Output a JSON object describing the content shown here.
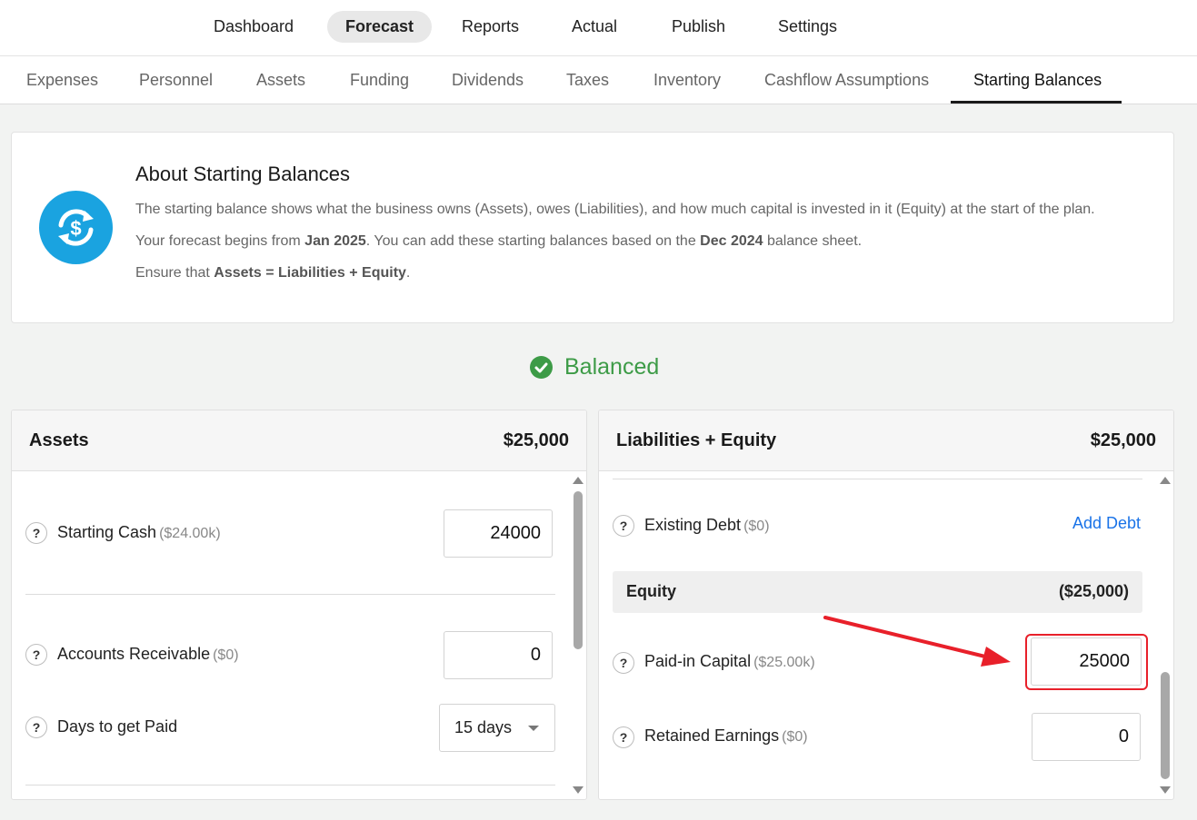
{
  "topnav": [
    "Dashboard",
    "Forecast",
    "Reports",
    "Actual",
    "Publish",
    "Settings"
  ],
  "subnav": [
    "Expenses",
    "Personnel",
    "Assets",
    "Funding",
    "Dividends",
    "Taxes",
    "Inventory",
    "Cashflow Assumptions",
    "Starting Balances"
  ],
  "about": {
    "title": "About Starting Balances",
    "line1": "The starting balance shows what the business owns (Assets), owes (Liabilities), and how much capital is invested in it (Equity) at the start of the plan.",
    "line2_a": "Your forecast begins from ",
    "line2_b": "Jan 2025",
    "line2_c": ". You can add these starting balances based on the ",
    "line2_d": "Dec 2024",
    "line2_e": " balance sheet.",
    "line3_a": "Ensure that ",
    "line3_b": "Assets = Liabilities + Equity",
    "line3_c": "."
  },
  "status": {
    "label": "Balanced",
    "color": "#3d9b47"
  },
  "assets": {
    "title": "Assets",
    "total": "$25,000",
    "starting_cash": {
      "label": "Starting Cash",
      "sub": "($24.00k)",
      "value": "24000"
    },
    "accounts_receivable": {
      "label": "Accounts Receivable",
      "sub": "($0)",
      "value": "0"
    },
    "days_to_get_paid": {
      "label": "Days to get Paid",
      "value": "15 days"
    }
  },
  "liabilities": {
    "title": "Liabilities + Equity",
    "total": "$25,000",
    "existing_debt": {
      "label": "Existing Debt",
      "sub": "($0)",
      "action": "Add Debt"
    },
    "equity": {
      "label": "Equity",
      "value": "($25,000)"
    },
    "paid_in_capital": {
      "label": "Paid-in Capital",
      "sub": "($25.00k)",
      "value": "25000"
    },
    "retained_earnings": {
      "label": "Retained Earnings",
      "sub": "($0)",
      "value": "0"
    }
  },
  "help_symbol": "?",
  "colors": {
    "accent": "#1aa3e0",
    "link": "#1a73e8",
    "annotation": "#e8202a"
  }
}
